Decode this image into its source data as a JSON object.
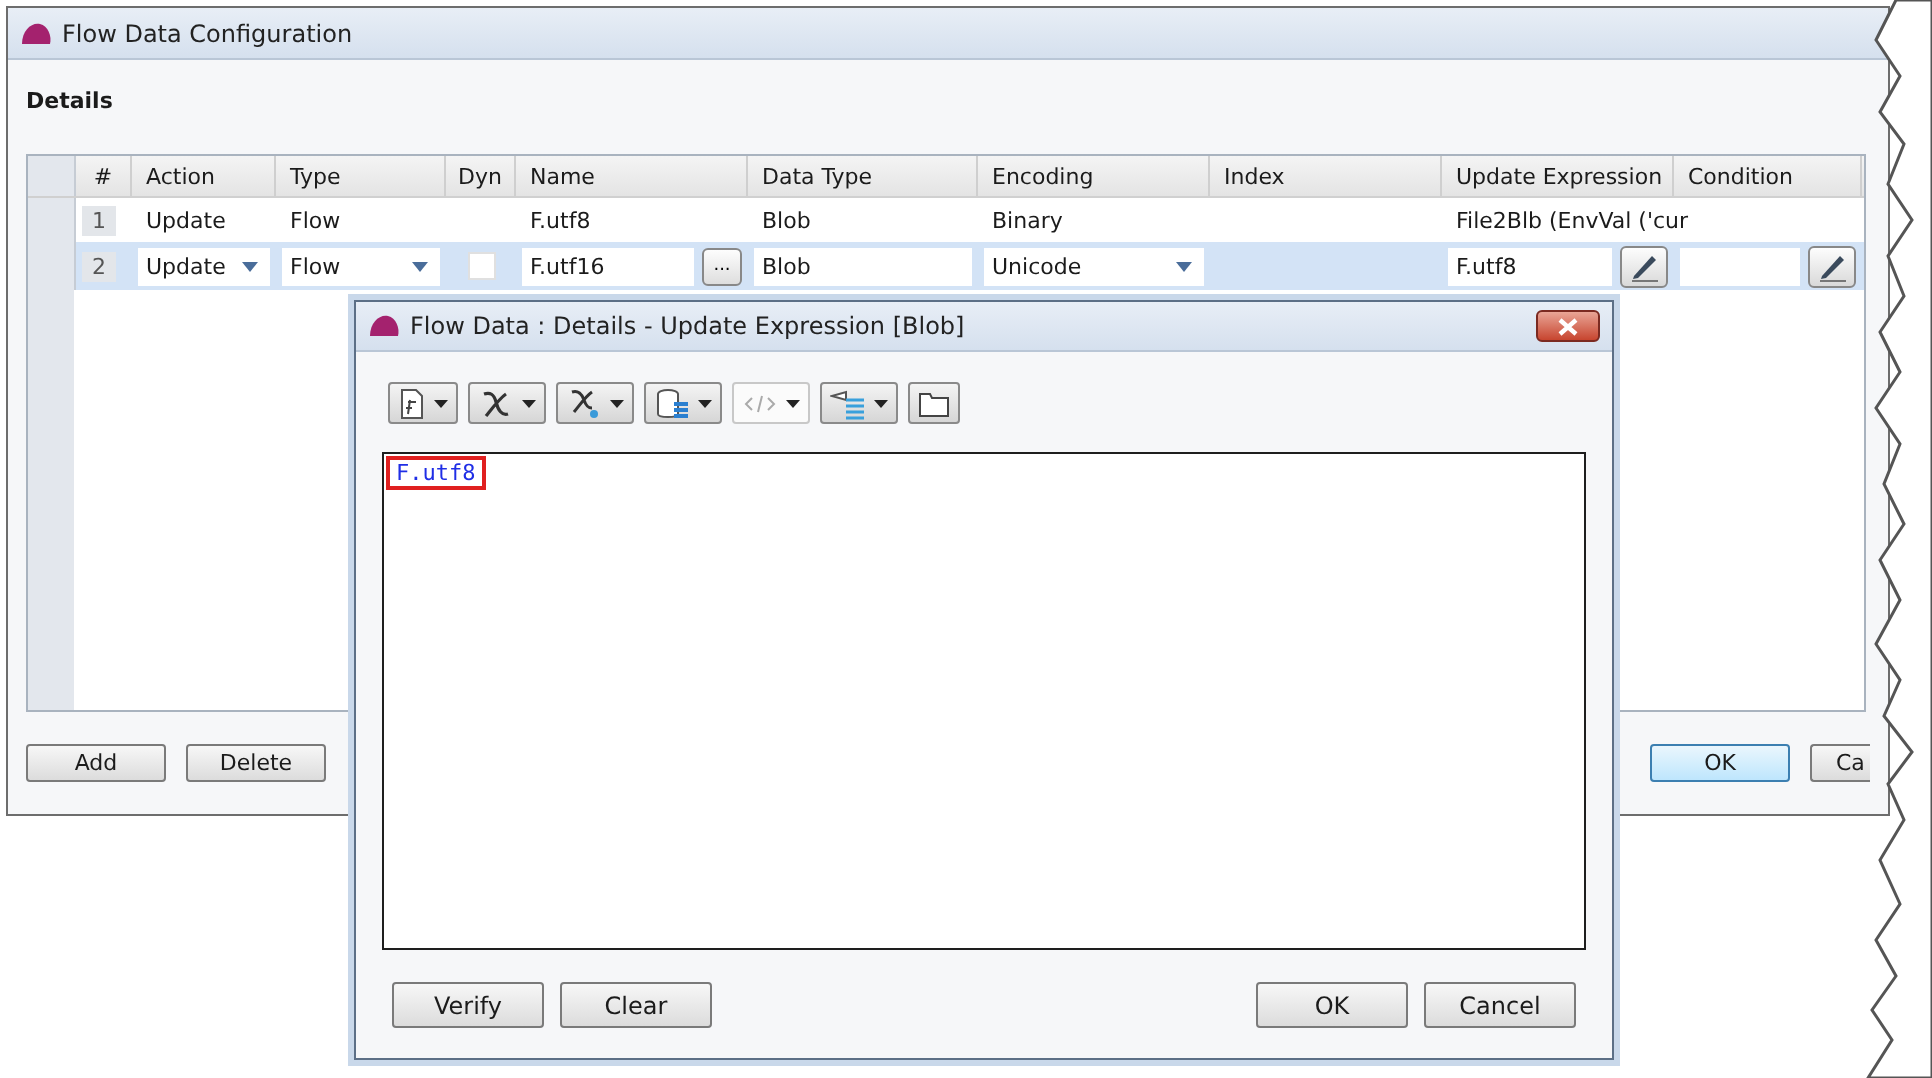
{
  "window": {
    "title": "Flow Data Configuration"
  },
  "section_title": "Details",
  "table": {
    "columns": [
      "#",
      "Action",
      "Type",
      "Dyn",
      "Name",
      "Data Type",
      "Encoding",
      "Index",
      "Update Expression",
      "Condition"
    ],
    "rows": [
      {
        "kind": "view",
        "selected": false,
        "number": "1",
        "action": "Update",
        "type": "Flow",
        "name": "F.utf8",
        "data_type": "Blob",
        "encoding": "Binary",
        "update_expression": "File2Blb (EnvVal ('cur"
      },
      {
        "kind": "edit",
        "selected": true,
        "number": "2",
        "action": "Update",
        "type": "Flow",
        "dyn_checked": false,
        "name": "F.utf16",
        "browse": "...",
        "data_type": "Blob",
        "encoding": "Unicode",
        "update_expression": "F.utf8"
      }
    ]
  },
  "buttons": [
    {
      "label": "Add",
      "default": false
    },
    {
      "label": "Delete",
      "default": false
    }
  ],
  "right_buttons": [
    {
      "label": "OK",
      "default": true
    },
    {
      "label": "Ca",
      "default": false
    }
  ],
  "dialog": {
    "title": "Flow Data : Details - Update Expression [Blob]",
    "toolbar": [
      {
        "kind": "document",
        "disabled": false
      },
      {
        "kind": "function",
        "disabled": false
      },
      {
        "kind": "variable",
        "disabled": false
      },
      {
        "kind": "database",
        "disabled": false
      },
      {
        "kind": "code",
        "disabled": true
      },
      {
        "kind": "list",
        "disabled": false
      },
      {
        "kind": "folder",
        "disabled": false
      }
    ],
    "expression": "F.utf8",
    "left_buttons": [
      "Verify",
      "Clear"
    ],
    "right_buttons": [
      "OK",
      "Cancel"
    ]
  }
}
